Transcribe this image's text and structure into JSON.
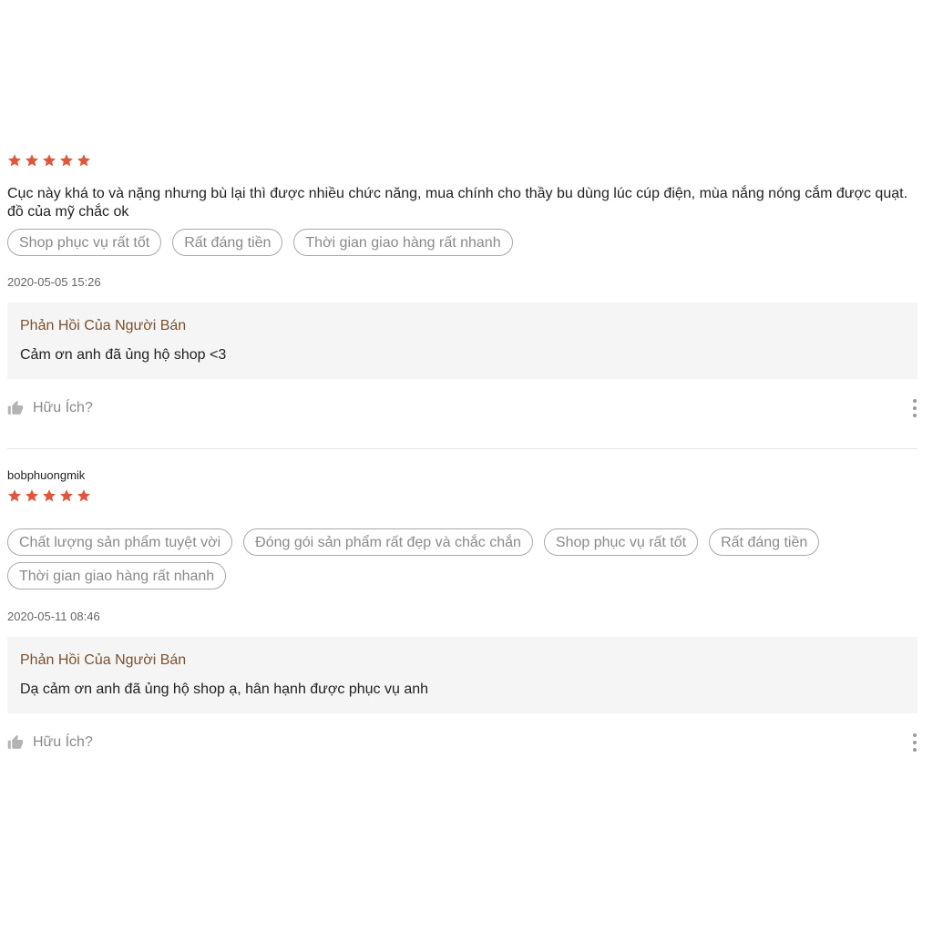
{
  "colors": {
    "star": "#e0563b",
    "reply_title": "#7a5230",
    "tag_text": "#8a8a8a"
  },
  "reviews": [
    {
      "username": "",
      "rating": 5,
      "comment": "Cục này khá to và nặng nhưng bù lại thì được nhiều chức năng, mua chính cho thầy bu dùng lúc cúp điện, mùa nắng nóng cắm được quạt. đồ của mỹ chắc ok",
      "tags": [
        "Shop phục vụ rất tốt",
        "Rất đáng tiền",
        "Thời gian giao hàng rất nhanh"
      ],
      "timestamp": "2020-05-05 15:26",
      "reply_title": "Phản Hồi Của Người Bán",
      "reply_text": "Cảm ơn anh đã ủng hộ shop <3",
      "helpful_label": "Hữu Ích?"
    },
    {
      "username": "bobphuongmik",
      "rating": 5,
      "comment": "",
      "tags": [
        "Chất lượng sản phẩm tuyệt vời",
        "Đóng gói sản phẩm rất đẹp và chắc chắn",
        "Shop phục vụ rất tốt",
        "Rất đáng tiền",
        "Thời gian giao hàng rất nhanh"
      ],
      "timestamp": "2020-05-11 08:46",
      "reply_title": "Phản Hồi Của Người Bán",
      "reply_text": "Dạ cảm ơn anh đã ủng hộ shop ạ, hân hạnh được phục vụ anh",
      "helpful_label": "Hữu Ích?"
    }
  ]
}
